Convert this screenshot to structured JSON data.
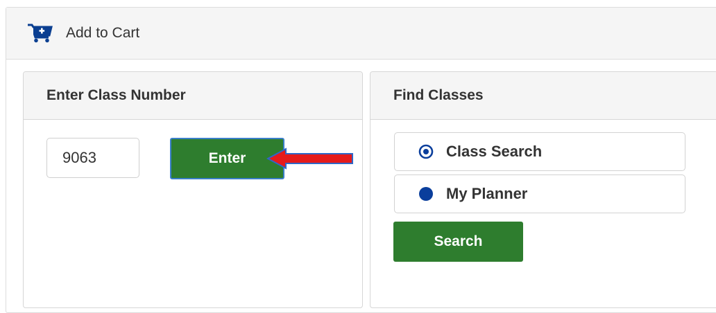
{
  "header": {
    "title": "Add to Cart",
    "icon": "cart-add-icon"
  },
  "enter_class": {
    "title": "Enter Class Number",
    "input_value": "9063",
    "enter_label": "Enter",
    "annotation_icon": "red-arrow-left-icon"
  },
  "find_classes": {
    "title": "Find Classes",
    "options": [
      {
        "label": "Class Search",
        "selected": true
      },
      {
        "label": "My Planner",
        "selected": false
      }
    ],
    "search_label": "Search"
  },
  "colors": {
    "primary_green": "#2e7d2e",
    "radio_blue": "#0a3e9c",
    "arrow_red": "#e51b1b",
    "arrow_outline": "#2f67c7"
  }
}
